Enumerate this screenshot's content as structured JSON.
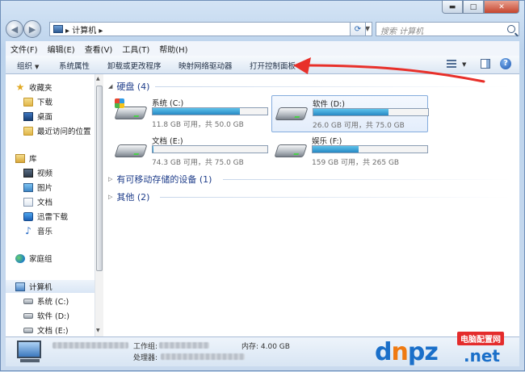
{
  "window": {
    "controls": {
      "minimize": "▬",
      "maximize": "□",
      "close": "✕"
    }
  },
  "nav": {
    "breadcrumb": "▸ 计算机 ▸",
    "search_placeholder": "搜索 计算机"
  },
  "menu": [
    "文件(F)",
    "编辑(E)",
    "查看(V)",
    "工具(T)",
    "帮助(H)"
  ],
  "commands": {
    "organize": "组织",
    "system_properties": "系统属性",
    "uninstall": "卸载或更改程序",
    "map_drive": "映射网络驱动器",
    "control_panel": "打开控制面板"
  },
  "sidebar": {
    "favorites": "收藏夹",
    "downloads": "下载",
    "desktop": "桌面",
    "recent": "最近访问的位置",
    "libraries": "库",
    "videos": "视频",
    "pictures": "图片",
    "documents": "文档",
    "xunlei": "迅雷下载",
    "music": "音乐",
    "homegroup": "家庭组",
    "computer": "计算机",
    "drive_c": "系统 (C:)",
    "drive_d": "软件 (D:)",
    "drive_e": "文档 (E:)"
  },
  "groups": {
    "hdd": "硬盘 (4)",
    "removable": "有可移动存储的设备 (1)",
    "other": "其他 (2)"
  },
  "drives": [
    {
      "name": "系统 (C:)",
      "size_text": "11.8 GB 可用，共 50.0 GB",
      "used_fraction": 0.764
    },
    {
      "name": "软件 (D:)",
      "size_text": "26.0 GB 可用，共 75.0 GB",
      "used_fraction": 0.653
    },
    {
      "name": "文档 (E:)",
      "size_text": "74.3 GB 可用，共 75.0 GB",
      "used_fraction": 0.009
    },
    {
      "name": "娱乐 (F:)",
      "size_text": "159 GB 可用，共 265 GB",
      "used_fraction": 0.4
    }
  ],
  "details": {
    "workgroup_label": "工作组:",
    "memory_label": "内存: 4.00 GB",
    "processor_label": "处理器:"
  },
  "watermark": {
    "main_d": "d",
    "main_n": "n",
    "main_pz": "pz",
    "net": ".net",
    "badge": "电脑配置网"
  },
  "colors": {
    "bar_fill": "#2788c4",
    "arrow": "#e8302a",
    "group_text": "#1e3d8a"
  }
}
